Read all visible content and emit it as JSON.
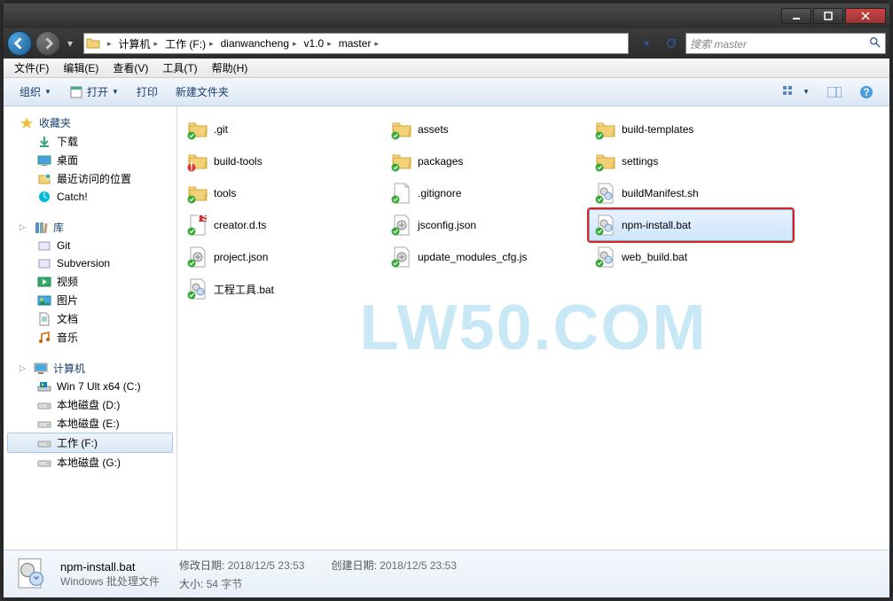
{
  "breadcrumb": [
    "计算机",
    "工作 (F:)",
    "dianwancheng",
    "v1.0",
    "master"
  ],
  "search_placeholder": "搜索 master",
  "menu": {
    "file": "文件(F)",
    "edit": "编辑(E)",
    "view": "查看(V)",
    "tools": "工具(T)",
    "help": "帮助(H)"
  },
  "toolbar": {
    "organize": "组织",
    "open": "打开",
    "print": "打印",
    "newfolder": "新建文件夹"
  },
  "sidebar": {
    "favorites": {
      "label": "收藏夹",
      "items": [
        "下载",
        "桌面",
        "最近访问的位置",
        "Catch!"
      ]
    },
    "libraries": {
      "label": "库",
      "items": [
        "Git",
        "Subversion",
        "视频",
        "图片",
        "文档",
        "音乐"
      ]
    },
    "computer": {
      "label": "计算机",
      "items": [
        "Win 7 Ult x64 (C:)",
        "本地磁盘 (D:)",
        "本地磁盘 (E:)",
        "工作 (F:)",
        "本地磁盘 (G:)"
      ],
      "selected": 3
    }
  },
  "files": [
    {
      "name": ".git",
      "type": "folder"
    },
    {
      "name": "assets",
      "type": "folder"
    },
    {
      "name": "build-templates",
      "type": "folder"
    },
    {
      "name": "build-tools",
      "type": "folder-warn"
    },
    {
      "name": "packages",
      "type": "folder"
    },
    {
      "name": "settings",
      "type": "folder"
    },
    {
      "name": "tools",
      "type": "folder"
    },
    {
      "name": ".gitignore",
      "type": "file"
    },
    {
      "name": "buildManifest.sh",
      "type": "sh"
    },
    {
      "name": "creator.d.ts",
      "type": "ts"
    },
    {
      "name": "jsconfig.json",
      "type": "json"
    },
    {
      "name": "npm-install.bat",
      "type": "bat",
      "selected": true,
      "highlight": true
    },
    {
      "name": "project.json",
      "type": "json"
    },
    {
      "name": "update_modules_cfg.js",
      "type": "js"
    },
    {
      "name": "web_build.bat",
      "type": "bat"
    },
    {
      "name": "工程工具.bat",
      "type": "bat"
    }
  ],
  "details": {
    "name": "npm-install.bat",
    "type": "Windows 批处理文件",
    "mod_label": "修改日期:",
    "mod_val": "2018/12/5 23:53",
    "create_label": "创建日期:",
    "create_val": "2018/12/5 23:53",
    "size_label": "大小:",
    "size_val": "54 字节"
  },
  "watermark": "LW50.COM"
}
